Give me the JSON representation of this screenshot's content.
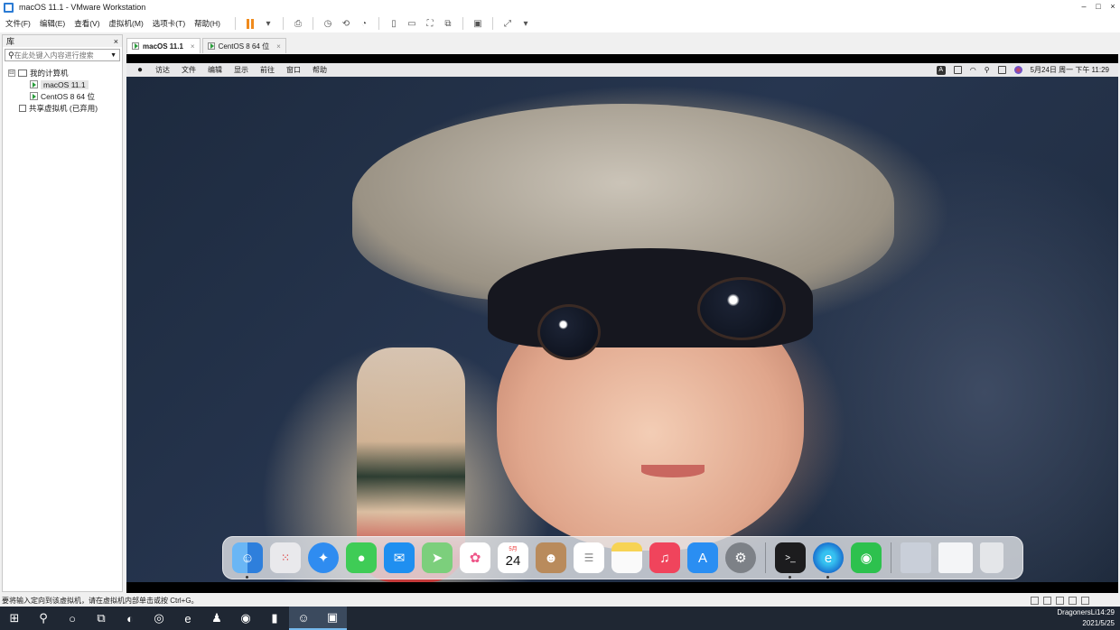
{
  "window": {
    "title": "macOS 11.1 - VMware Workstation",
    "controls": [
      "–",
      "□",
      "×"
    ]
  },
  "menu": [
    "文件(F)",
    "编辑(E)",
    "查看(V)",
    "虚拟机(M)",
    "选项卡(T)",
    "帮助(H)"
  ],
  "library": {
    "title": "库",
    "close": "×",
    "search_placeholder": "在此处键入内容进行搜索",
    "tree": {
      "root": "我的计算机",
      "vms": [
        "macOS 11.1",
        "CentOS 8 64 位"
      ],
      "shared": "共享虚拟机 (已弃用)",
      "expander": "⊟"
    }
  },
  "tabs": [
    {
      "label": "macOS 11.1",
      "active": true
    },
    {
      "label": "CentOS 8 64 位",
      "active": false
    }
  ],
  "mac": {
    "menus": [
      "访达",
      "文件",
      "编辑",
      "显示",
      "前往",
      "窗口",
      "帮助"
    ],
    "clock": "5月24日 周一 下午 11:29",
    "input_method": "A",
    "calendar": {
      "month": "5月",
      "day": "24"
    }
  },
  "dock": [
    "finder-icon",
    "launchpad-icon",
    "safari-icon",
    "messages-icon",
    "mail-icon",
    "maps-icon",
    "photos-icon",
    "calendar-icon",
    "contacts-icon",
    "reminders-icon",
    "notes-icon",
    "music-icon",
    "appstore-icon",
    "system-preferences-icon",
    "terminal-icon",
    "edge-icon",
    "wechat-icon",
    "screenshot-thumbnail",
    "window-thumbnail",
    "trash-icon"
  ],
  "status": {
    "message": "要将输入定向到该虚拟机，请在虚拟机内部单击或按 Ctrl+G。"
  },
  "taskbar": {
    "user": "DragonersLi",
    "time": "14:29",
    "date": "2021/5/25"
  }
}
